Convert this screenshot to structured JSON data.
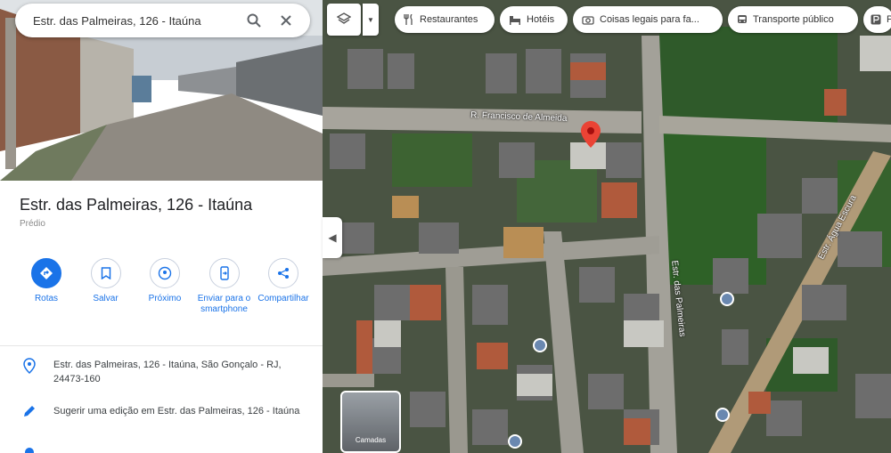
{
  "search": {
    "value": "Estr. das Palmeiras, 126 - Itaúna"
  },
  "top_chips": [
    {
      "label": "Restaurantes",
      "icon": "fork-knife-icon"
    },
    {
      "label": "Hotéis",
      "icon": "bed-icon"
    },
    {
      "label": "Coisas legais para fa...",
      "icon": "camera-icon"
    },
    {
      "label": "Transporte público",
      "icon": "bus-icon"
    },
    {
      "label": "P",
      "icon": "parking-icon"
    }
  ],
  "place": {
    "title": "Estr. das Palmeiras, 126 - Itaúna",
    "subtitle": "Prédio"
  },
  "actions": [
    {
      "label": "Rotas",
      "icon": "directions-icon"
    },
    {
      "label": "Salvar",
      "icon": "bookmark-icon"
    },
    {
      "label": "Próximo",
      "icon": "nearby-icon"
    },
    {
      "label": "Enviar para o smartphone",
      "icon": "send-to-phone-icon"
    },
    {
      "label": "Compartilhar",
      "icon": "share-icon"
    }
  ],
  "info": {
    "address": "Estr. das Palmeiras, 126 - Itaúna, São Gonçalo - RJ, 24473-160",
    "suggest_edit": "Sugerir uma edição em Estr. das Palmeiras, 126 - Itaúna"
  },
  "map_labels": {
    "street_top": "R. Francisco de Almeida",
    "street_right": "Estr. das Palmeiras",
    "street_far_right": "Estr. Água Escura"
  },
  "thumbnail": {
    "label": "Camadas"
  },
  "colors": {
    "accent": "#1a73e8",
    "pin": "#ea4335"
  }
}
